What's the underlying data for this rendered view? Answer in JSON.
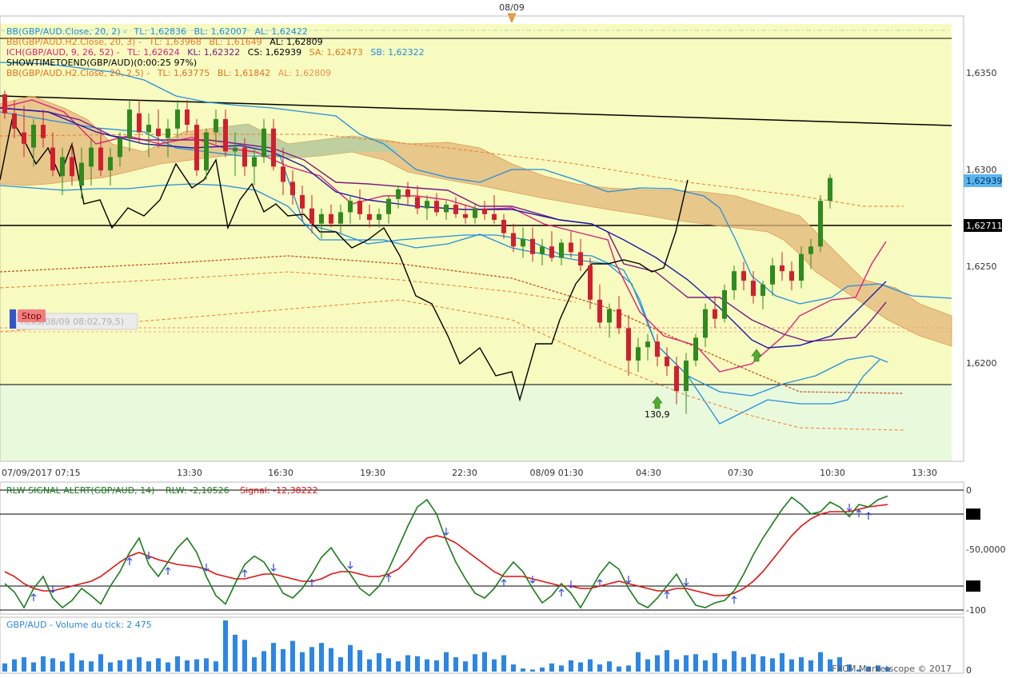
{
  "top_date_label": "08/09",
  "colors": {
    "background_upper_band": "#f7fbbf",
    "background_lower_band": "#e9f9dc",
    "bull_candle": "#2e8b1e",
    "bear_candle": "#d21f2f",
    "bollinger_blue": "#1f8fe0",
    "bollinger_orange": "#f07a2a",
    "ichimoku_kumo": "#e3b67a",
    "price_badge": "#5bb6f0",
    "rlw_green": "#1b7d1b",
    "rlw_red": "#e31010",
    "volume_bar": "#2b86e6"
  },
  "legends": {
    "bb1": {
      "prefix": "BB(GBP/AUD.Close, 20, 2) -",
      "tl": "TL: 1,62836",
      "bl": "BL: 1,62007",
      "al": "AL: 1,62422"
    },
    "bb2": {
      "prefix": "BB(GBP/AUD.H2.Close, 20, 3) -",
      "tl": "TL: 1,63968",
      "bl": "BL: 1,61649",
      "al": "AL: 1,62809"
    },
    "ich": {
      "prefix": "ICH(GBP/AUD, 9, 26, 52) -",
      "tl": "TL: 1,62624",
      "kl": "KL: 1,62322",
      "cs": "CS: 1,62939",
      "sa": "SA: 1,62473",
      "sb": "SB: 1,62322"
    },
    "showtime": "SHOWTIMETOEND(GBP/AUD)(0:00:25 97%)",
    "bb3": {
      "prefix": "BB(GBP/AUD.H2.Close, 20, 2.5) -",
      "tl": "TL: 1,63775",
      "bl": "BL: 1,61842",
      "al": "AL: 1,62809"
    }
  },
  "stop_button": "Stop",
  "stop_tooltip": "Ticks(08/09 08:02,79,5)",
  "signal_arrow_label": "130,9",
  "price_axis": {
    "ticks": [
      "1,6350",
      "1,6300",
      "1,6250",
      "1,6200"
    ],
    "current_price": "1,62939",
    "line_price": "1,62711"
  },
  "time_axis": [
    "07/09/2017 07:15",
    "13:30",
    "16:30",
    "19:30",
    "22:30",
    "08/09 01:30",
    "04:30",
    "07:30",
    "10:30",
    "13:30"
  ],
  "rlw": {
    "legend_name": "RLW SIGNAL ALERT(GBP/AUD, 14)",
    "legend_rlw": "RLW: -2,10526",
    "legend_signal": "Signal: -12,38222",
    "axis_top": "0",
    "axis_mid": "-50,0000",
    "axis_bottom": "-100"
  },
  "volume": {
    "legend": "GBP/AUD - Volume du tick: 2 475",
    "axis_bottom": "0",
    "copyright": "FXCM Marketscope © 2017"
  },
  "chart_data": {
    "type": "candlestick",
    "symbol": "GBP/AUD",
    "price_range": [
      1.6145,
      1.6375
    ],
    "candles_ohlc": [
      [
        1.6338,
        1.634,
        1.6325,
        1.6328
      ],
      [
        1.6328,
        1.6335,
        1.6315,
        1.632
      ],
      [
        1.6318,
        1.6332,
        1.6305,
        1.6312
      ],
      [
        1.631,
        1.6325,
        1.63,
        1.6322
      ],
      [
        1.6322,
        1.633,
        1.631,
        1.6315
      ],
      [
        1.631,
        1.6318,
        1.6295,
        1.6298
      ],
      [
        1.6295,
        1.631,
        1.6285,
        1.6305
      ],
      [
        1.6305,
        1.6312,
        1.629,
        1.6295
      ],
      [
        1.629,
        1.631,
        1.6283,
        1.6302
      ],
      [
        1.63,
        1.6315,
        1.629,
        1.631
      ],
      [
        1.631,
        1.632,
        1.6295,
        1.6298
      ],
      [
        1.6298,
        1.631,
        1.629,
        1.6305
      ],
      [
        1.6305,
        1.6318,
        1.63,
        1.6315
      ],
      [
        1.6315,
        1.6335,
        1.6308,
        1.633
      ],
      [
        1.6328,
        1.6335,
        1.6312,
        1.6318
      ],
      [
        1.6318,
        1.6328,
        1.6305,
        1.6322
      ],
      [
        1.632,
        1.633,
        1.631,
        1.6316
      ],
      [
        1.6315,
        1.6325,
        1.6305,
        1.632
      ],
      [
        1.632,
        1.6335,
        1.6315,
        1.633
      ],
      [
        1.633,
        1.6335,
        1.6318,
        1.6322
      ],
      [
        1.6322,
        1.6325,
        1.6295,
        1.6298
      ],
      [
        1.6298,
        1.632,
        1.6293,
        1.6318
      ],
      [
        1.6318,
        1.633,
        1.6312,
        1.6325
      ],
      [
        1.6325,
        1.633,
        1.6305,
        1.6308
      ],
      [
        1.6308,
        1.6318,
        1.6295,
        1.631
      ],
      [
        1.631,
        1.6315,
        1.6295,
        1.63
      ],
      [
        1.63,
        1.631,
        1.629,
        1.6305
      ],
      [
        1.6305,
        1.6325,
        1.6302,
        1.632
      ],
      [
        1.632,
        1.6325,
        1.6298,
        1.63
      ],
      [
        1.63,
        1.631,
        1.6285,
        1.6292
      ],
      [
        1.6292,
        1.6298,
        1.628,
        1.6285
      ],
      [
        1.6285,
        1.629,
        1.6272,
        1.6278
      ],
      [
        1.6278,
        1.6285,
        1.6265,
        1.627
      ],
      [
        1.627,
        1.6278,
        1.6262,
        1.6275
      ],
      [
        1.6275,
        1.628,
        1.6268,
        1.627
      ],
      [
        1.627,
        1.628,
        1.6265,
        1.6276
      ],
      [
        1.6276,
        1.6285,
        1.627,
        1.6282
      ],
      [
        1.6282,
        1.6288,
        1.6272,
        1.6275
      ],
      [
        1.6275,
        1.628,
        1.6268,
        1.6272
      ],
      [
        1.6272,
        1.6278,
        1.6268,
        1.6275
      ],
      [
        1.6275,
        1.6285,
        1.627,
        1.6283
      ],
      [
        1.6283,
        1.629,
        1.6278,
        1.6288
      ],
      [
        1.6288,
        1.6292,
        1.628,
        1.6284
      ],
      [
        1.6284,
        1.629,
        1.6275,
        1.6278
      ],
      [
        1.6278,
        1.6285,
        1.6272,
        1.6282
      ],
      [
        1.6282,
        1.6286,
        1.6274,
        1.6276
      ],
      [
        1.6276,
        1.6282,
        1.6272,
        1.628
      ],
      [
        1.628,
        1.6284,
        1.6273,
        1.6275
      ],
      [
        1.6275,
        1.628,
        1.627,
        1.6273
      ],
      [
        1.6273,
        1.628,
        1.627,
        1.6278
      ],
      [
        1.6278,
        1.6282,
        1.6272,
        1.6275
      ],
      [
        1.6275,
        1.6285,
        1.627,
        1.6272
      ],
      [
        1.6272,
        1.6275,
        1.6262,
        1.6265
      ],
      [
        1.6265,
        1.627,
        1.6255,
        1.6258
      ],
      [
        1.6258,
        1.6268,
        1.6252,
        1.6262
      ],
      [
        1.6262,
        1.6268,
        1.625,
        1.6254
      ],
      [
        1.6254,
        1.6262,
        1.6248,
        1.6258
      ],
      [
        1.6258,
        1.6266,
        1.625,
        1.6252
      ],
      [
        1.6252,
        1.6262,
        1.6248,
        1.626
      ],
      [
        1.626,
        1.6266,
        1.6252,
        1.6255
      ],
      [
        1.6255,
        1.6262,
        1.6245,
        1.6248
      ],
      [
        1.6248,
        1.6252,
        1.6225,
        1.623
      ],
      [
        1.623,
        1.6238,
        1.6215,
        1.6218
      ],
      [
        1.6218,
        1.6228,
        1.621,
        1.6225
      ],
      [
        1.6225,
        1.6232,
        1.6212,
        1.6215
      ],
      [
        1.6215,
        1.6222,
        1.619,
        1.6198
      ],
      [
        1.6198,
        1.621,
        1.6192,
        1.6205
      ],
      [
        1.6205,
        1.6212,
        1.6198,
        1.6208
      ],
      [
        1.6208,
        1.6212,
        1.6195,
        1.62
      ],
      [
        1.62,
        1.6205,
        1.619,
        1.6195
      ],
      [
        1.6195,
        1.62,
        1.6175,
        1.6182
      ],
      [
        1.6182,
        1.6202,
        1.617,
        1.6198
      ],
      [
        1.6198,
        1.6212,
        1.6195,
        1.621
      ],
      [
        1.621,
        1.6228,
        1.6205,
        1.6225
      ],
      [
        1.6225,
        1.6232,
        1.6215,
        1.622
      ],
      [
        1.622,
        1.6238,
        1.6218,
        1.6235
      ],
      [
        1.6235,
        1.6248,
        1.623,
        1.6245
      ],
      [
        1.6245,
        1.625,
        1.6235,
        1.624
      ],
      [
        1.624,
        1.6245,
        1.6228,
        1.6232
      ],
      [
        1.6232,
        1.624,
        1.6225,
        1.6238
      ],
      [
        1.6238,
        1.6252,
        1.6232,
        1.6248
      ],
      [
        1.6248,
        1.6255,
        1.624,
        1.6245
      ],
      [
        1.6245,
        1.625,
        1.6235,
        1.624
      ],
      [
        1.624,
        1.6258,
        1.6236,
        1.6254
      ],
      [
        1.6254,
        1.6262,
        1.6246,
        1.6258
      ],
      [
        1.6258,
        1.6285,
        1.6255,
        1.6282
      ],
      [
        1.6282,
        1.6296,
        1.6278,
        1.6294
      ]
    ],
    "signal_arrow": {
      "candle_index": 65,
      "value": 130.9
    },
    "rlw_range": [
      -100,
      0
    ],
    "rlw_values": [
      -78,
      -85,
      -98,
      -82,
      -72,
      -90,
      -98,
      -92,
      -82,
      -88,
      -95,
      -80,
      -68,
      -52,
      -40,
      -62,
      -72,
      -60,
      -48,
      -40,
      -52,
      -72,
      -88,
      -95,
      -78,
      -62,
      -55,
      -60,
      -72,
      -86,
      -90,
      -82,
      -70,
      -56,
      -48,
      -60,
      -70,
      -82,
      -88,
      -80,
      -66,
      -48,
      -30,
      -14,
      -8,
      -20,
      -42,
      -60,
      -74,
      -86,
      -90,
      -82,
      -70,
      -60,
      -68,
      -82,
      -94,
      -88,
      -78,
      -86,
      -98,
      -84,
      -70,
      -60,
      -66,
      -82,
      -94,
      -98,
      -90,
      -80,
      -70,
      -84,
      -96,
      -98,
      -94,
      -92,
      -84,
      -70,
      -54,
      -40,
      -28,
      -16,
      -6,
      -12,
      -20,
      -18,
      -10,
      -14,
      -22,
      -12,
      -14,
      -8,
      -5
    ],
    "rlw_signal": [
      -68,
      -72,
      -78,
      -82,
      -84,
      -84,
      -82,
      -80,
      -78,
      -76,
      -72,
      -66,
      -60,
      -55,
      -52,
      -55,
      -58,
      -60,
      -62,
      -63,
      -64,
      -66,
      -70,
      -72,
      -74,
      -74,
      -72,
      -70,
      -70,
      -72,
      -74,
      -76,
      -76,
      -74,
      -70,
      -68,
      -68,
      -70,
      -72,
      -72,
      -70,
      -66,
      -58,
      -48,
      -40,
      -38,
      -40,
      -44,
      -50,
      -56,
      -62,
      -68,
      -72,
      -72,
      -72,
      -74,
      -76,
      -78,
      -80,
      -80,
      -82,
      -82,
      -80,
      -78,
      -76,
      -78,
      -80,
      -82,
      -84,
      -84,
      -82,
      -82,
      -84,
      -86,
      -88,
      -88,
      -86,
      -82,
      -76,
      -68,
      -58,
      -48,
      -38,
      -30,
      -24,
      -20,
      -18,
      -18,
      -18,
      -16,
      -14,
      -13,
      -12
    ],
    "volume_max": 250,
    "volume": [
      40,
      60,
      70,
      45,
      75,
      65,
      50,
      90,
      55,
      50,
      85,
      45,
      55,
      60,
      70,
      50,
      65,
      45,
      75,
      55,
      60,
      65,
      50,
      260,
      180,
      155,
      70,
      100,
      140,
      110,
      150,
      95,
      120,
      140,
      115,
      70,
      130,
      105,
      60,
      90,
      65,
      50,
      80,
      75,
      60,
      55,
      95,
      70,
      50,
      85,
      95,
      60,
      80,
      35,
      15,
      10,
      20,
      40,
      30,
      55,
      45,
      60,
      35,
      50,
      25,
      30,
      95,
      60,
      80,
      105,
      60,
      80,
      85,
      55,
      90,
      60,
      100,
      70,
      85,
      75,
      65,
      90,
      60,
      70,
      55,
      95,
      60,
      70,
      35,
      10,
      25,
      30,
      20
    ]
  }
}
